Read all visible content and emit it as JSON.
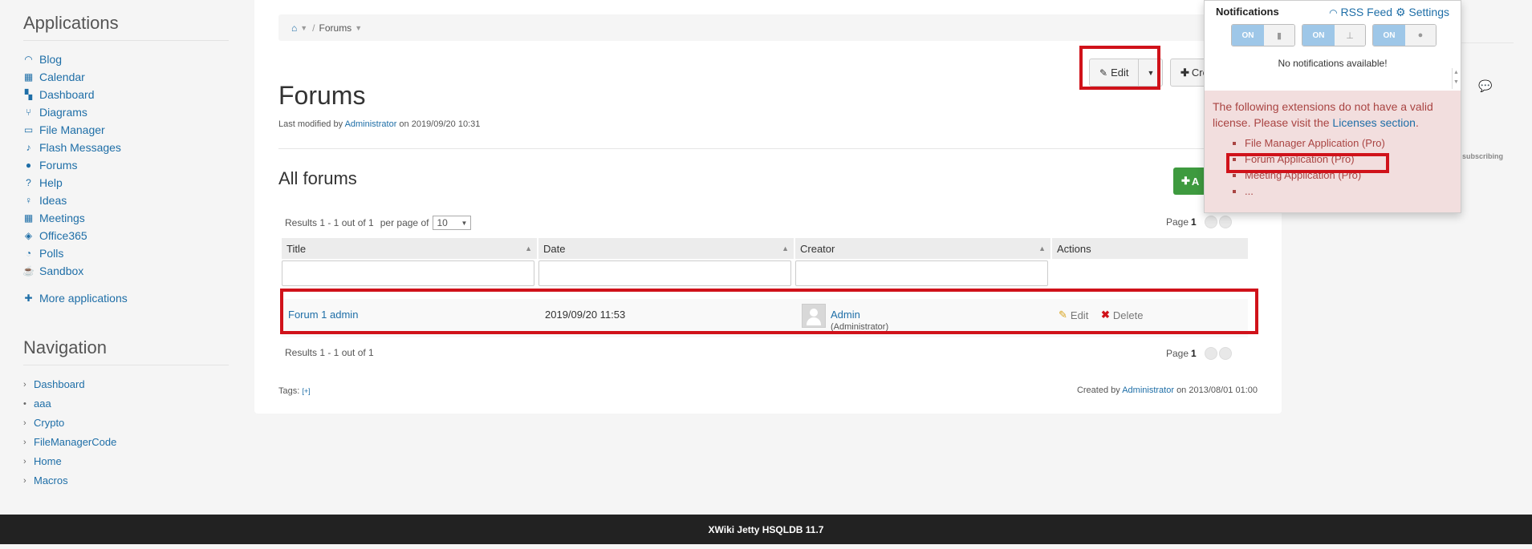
{
  "sidebar": {
    "applications_heading": "Applications",
    "applications": [
      {
        "label": "Blog",
        "icon": "rss-icon"
      },
      {
        "label": "Calendar",
        "icon": "calendar-icon"
      },
      {
        "label": "Dashboard",
        "icon": "dashboard-icon"
      },
      {
        "label": "Diagrams",
        "icon": "diagram-icon"
      },
      {
        "label": "File Manager",
        "icon": "folder-icon"
      },
      {
        "label": "Flash Messages",
        "icon": "bell-icon"
      },
      {
        "label": "Forums",
        "icon": "comments-icon"
      },
      {
        "label": "Help",
        "icon": "help-icon"
      },
      {
        "label": "Ideas",
        "icon": "lightbulb-icon"
      },
      {
        "label": "Meetings",
        "icon": "calendar-icon"
      },
      {
        "label": "Office365",
        "icon": "cube-icon"
      },
      {
        "label": "Polls",
        "icon": "pie-chart-icon"
      },
      {
        "label": "Sandbox",
        "icon": "coffee-icon"
      }
    ],
    "more_applications": "More applications",
    "navigation_heading": "Navigation",
    "navigation": [
      {
        "label": "Dashboard",
        "marker": "›"
      },
      {
        "label": "aaa",
        "marker": "•"
      },
      {
        "label": "Crypto",
        "marker": "›"
      },
      {
        "label": "FileManagerCode",
        "marker": "›"
      },
      {
        "label": "Home",
        "marker": "›"
      },
      {
        "label": "Macros",
        "marker": "›"
      }
    ]
  },
  "breadcrumb": {
    "home_icon": "home-icon",
    "current": "Forums"
  },
  "toolbar": {
    "edit_label": "Edit",
    "create_label": "Cre"
  },
  "page": {
    "title": "Forums",
    "last_modified_prefix": "Last modified by",
    "last_modified_user": "Administrator",
    "last_modified_suffix": "on 2019/09/20 10:31",
    "section_title": "All forums",
    "add_label": "A"
  },
  "livetable": {
    "results_text": "Results 1 - 1 out of 1",
    "per_page_label": "per page of",
    "per_page_value": "10",
    "page_label": "Page",
    "page_number": "1",
    "columns": [
      "Title",
      "Date",
      "Creator",
      "Actions"
    ],
    "rows": [
      {
        "title": "Forum 1 admin",
        "date": "2019/09/20 11:53",
        "creator_name": "Admin",
        "creator_username": "(Administrator)",
        "edit_label": "Edit",
        "delete_label": "Delete"
      }
    ],
    "bottom_results_text": "Results 1 - 1 out of 1"
  },
  "footer_meta": {
    "tags_label": "Tags:",
    "tags_add": "[+]",
    "created_prefix": "Created by",
    "created_user": "Administrator",
    "created_suffix": "on 2013/08/01 01:00"
  },
  "right_ghost": {
    "subscribing": "subscribing"
  },
  "notifications": {
    "title": "Notifications",
    "rss_label": "RSS Feed",
    "settings_label": "Settings",
    "toggle_on": "ON",
    "empty_text": "No notifications available!",
    "license_text": "The following extensions do not have a valid license. Please visit the",
    "license_link": "Licenses section",
    "license_period": ".",
    "extensions": [
      "File Manager Application (Pro)",
      "Forum Application (Pro)",
      "Meeting Application (Pro)",
      "..."
    ]
  },
  "footer": {
    "text": "XWiki Jetty HSQLDB 11.7"
  },
  "colors": {
    "link": "#1e6ea7",
    "highlight": "#d0121a",
    "license_bg": "#f2dede",
    "license_text": "#a94442",
    "add_button": "#3e9a3f",
    "footer_bg": "#222222"
  }
}
